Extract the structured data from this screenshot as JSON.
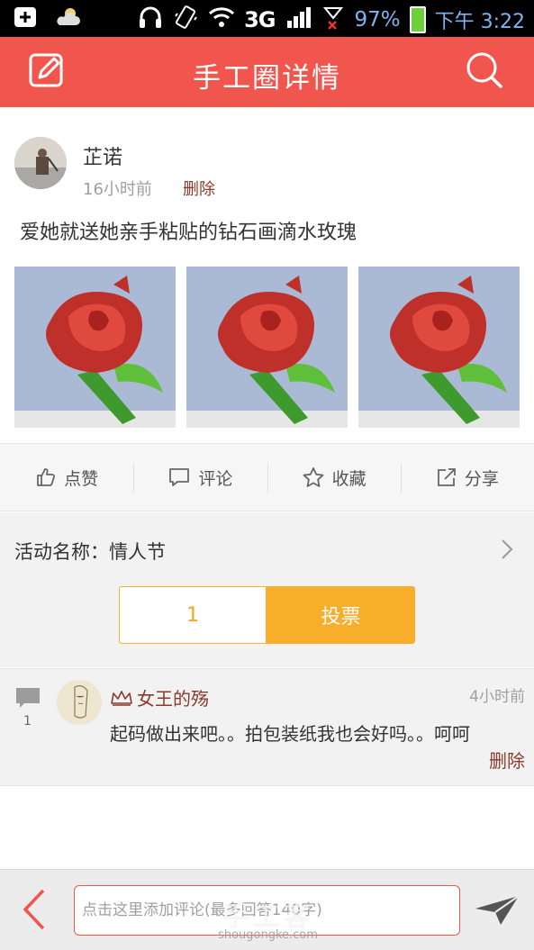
{
  "status_bar": {
    "network": "3G",
    "battery": "97%",
    "time": "下午 3:22"
  },
  "header": {
    "title": "手工圈详情"
  },
  "post": {
    "username": "芷诺",
    "time": "16小时前",
    "delete_label": "删除",
    "text": "爱她就送她亲手粘贴的钻石画滴水玫瑰",
    "photo_count": 3
  },
  "actions": {
    "like": "点赞",
    "comment": "评论",
    "favorite": "收藏",
    "share": "分享"
  },
  "activity": {
    "label": "活动名称：情人节",
    "vote_count": "1",
    "vote_button": "投票"
  },
  "comments": [
    {
      "count": "1",
      "name": "女王的殇",
      "time": "4小时前",
      "text": "起码做出来吧。。拍包装纸我也会好吗。。呵呵",
      "delete_label": "删除"
    }
  ],
  "bottom_bar": {
    "input_placeholder": "点击这里添加评论(最多回答140字)"
  },
  "watermark": {
    "main": "手工客",
    "url": "shougongke.com"
  },
  "colors": {
    "header_red": "#f0564d",
    "vote_orange": "#f8ae2b",
    "link_brown": "#8a3a2a"
  }
}
